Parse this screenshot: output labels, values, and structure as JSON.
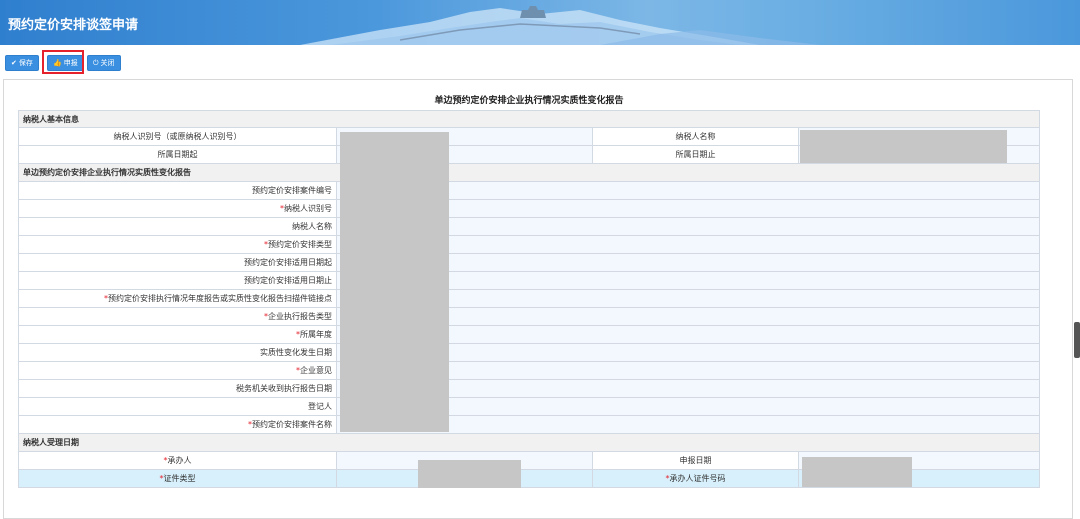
{
  "header": {
    "title": "预约定价安排谈签申请"
  },
  "toolbar": {
    "save": "保存",
    "submit": "申报",
    "close": "关闭"
  },
  "report_title": "单边预约定价安排企业执行情况实质性变化报告",
  "section1": {
    "title": "纳税人基本信息",
    "rows": [
      {
        "left_label": "纳税人识别号（或原纳税人识别号）",
        "right_label": "纳税人名称"
      },
      {
        "left_label": "所属日期起",
        "right_label": "所属日期止"
      }
    ]
  },
  "section2": {
    "title": "单边预约定价安排企业执行情况实质性变化报告",
    "fields": [
      {
        "label": "预约定价安排案件编号",
        "required": false
      },
      {
        "label": "纳税人识别号",
        "required": true
      },
      {
        "label": "纳税人名称",
        "required": false
      },
      {
        "label": "预约定价安排类型",
        "required": true
      },
      {
        "label": "预约定价安排适用日期起",
        "required": false
      },
      {
        "label": "预约定价安排适用日期止",
        "required": false
      },
      {
        "label": "预约定价安排执行情况年度报告或实质性变化报告扫描件链接点",
        "required": true
      },
      {
        "label": "企业执行报告类型",
        "required": true
      },
      {
        "label": "所属年度",
        "required": true
      },
      {
        "label": "实质性变化发生日期",
        "required": false
      },
      {
        "label": "企业意见",
        "required": true
      },
      {
        "label": "税务机关收到执行报告日期",
        "required": false
      },
      {
        "label": "登记人",
        "required": false
      },
      {
        "label": "预约定价安排案件名称",
        "required": true
      }
    ]
  },
  "section3": {
    "title": "纳税人受理日期",
    "rows": [
      {
        "left_label": "承办人",
        "left_required": true,
        "right_label": "申报日期",
        "right_required": false
      },
      {
        "left_label": "证件类型",
        "left_required": true,
        "right_label": "承办人证件号码",
        "right_required": true
      }
    ]
  },
  "required_mark": "*",
  "colors": {
    "header": "#3a8fe0",
    "accent": "#e5212c",
    "value_bg": "#f3f8fe",
    "highlight_bg": "#d7f0fb"
  },
  "icons": {
    "save": "check-circle-icon",
    "submit": "thumbs-up-icon",
    "close": "power-icon"
  }
}
